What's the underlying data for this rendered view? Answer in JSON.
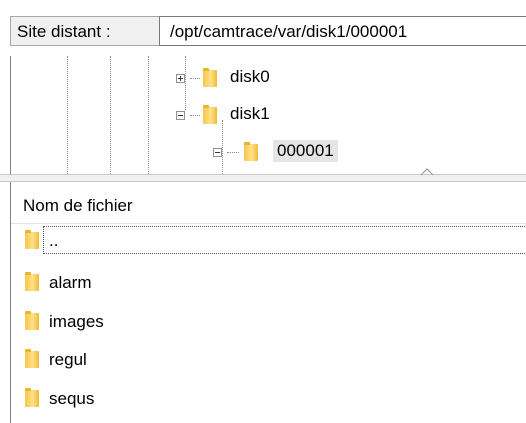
{
  "remote_site": {
    "label": "Site distant :",
    "path": "/opt/camtrace/var/disk1/000001"
  },
  "tree": {
    "items": [
      {
        "label": "disk0",
        "expander": "plus"
      },
      {
        "label": "disk1",
        "expander": "minus"
      },
      {
        "label": "000001",
        "expander": "minus",
        "selected": true
      }
    ]
  },
  "file_list": {
    "column_header": "Nom de fichier",
    "rows": [
      {
        "name": ".."
      },
      {
        "name": "alarm"
      },
      {
        "name": "images"
      },
      {
        "name": "regul"
      },
      {
        "name": "sequs"
      }
    ]
  },
  "icons": {
    "folder": "folder-icon",
    "expand": "plus-box-icon",
    "collapse": "minus-box-icon",
    "sort": "sort-ascending-icon"
  }
}
